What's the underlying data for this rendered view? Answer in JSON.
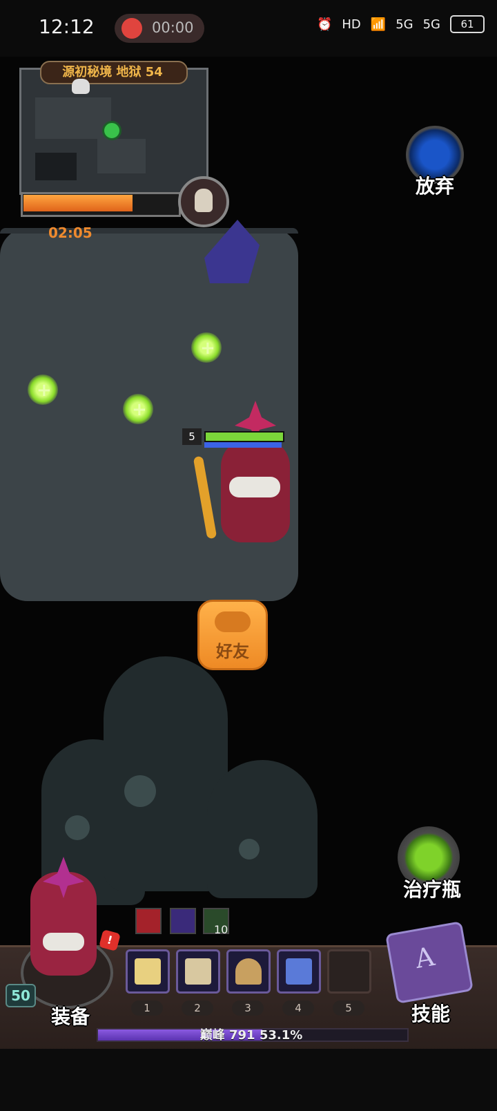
{
  "status_bar": {
    "time": "12:12",
    "recording": "00:00",
    "hd": "HD",
    "net1": "5G",
    "net2": "5G",
    "battery": "61"
  },
  "minimap": {
    "title": "源初秘境 地狱 54",
    "timer": "02:05",
    "progress_fraction": 0.72
  },
  "buttons": {
    "abandon": "放弃",
    "friend": "好友",
    "heal_potion": "治疗瓶",
    "equipment": "装备",
    "skills": "技能"
  },
  "player": {
    "level": "5",
    "hp_fraction": 1.0,
    "mp_fraction": 1.0
  },
  "hud": {
    "hero_level": "50",
    "alert": "!",
    "buff_stack": "10",
    "skill_slots": [
      "1",
      "2",
      "3",
      "4",
      "5"
    ],
    "xp_text": "巅峰 791 53.1%",
    "xp_fraction": 0.531
  },
  "colors": {
    "accent_orange": "#ef8a2e",
    "friend_button": "#ffb14a",
    "xp_purple": "#8a5ae0"
  }
}
